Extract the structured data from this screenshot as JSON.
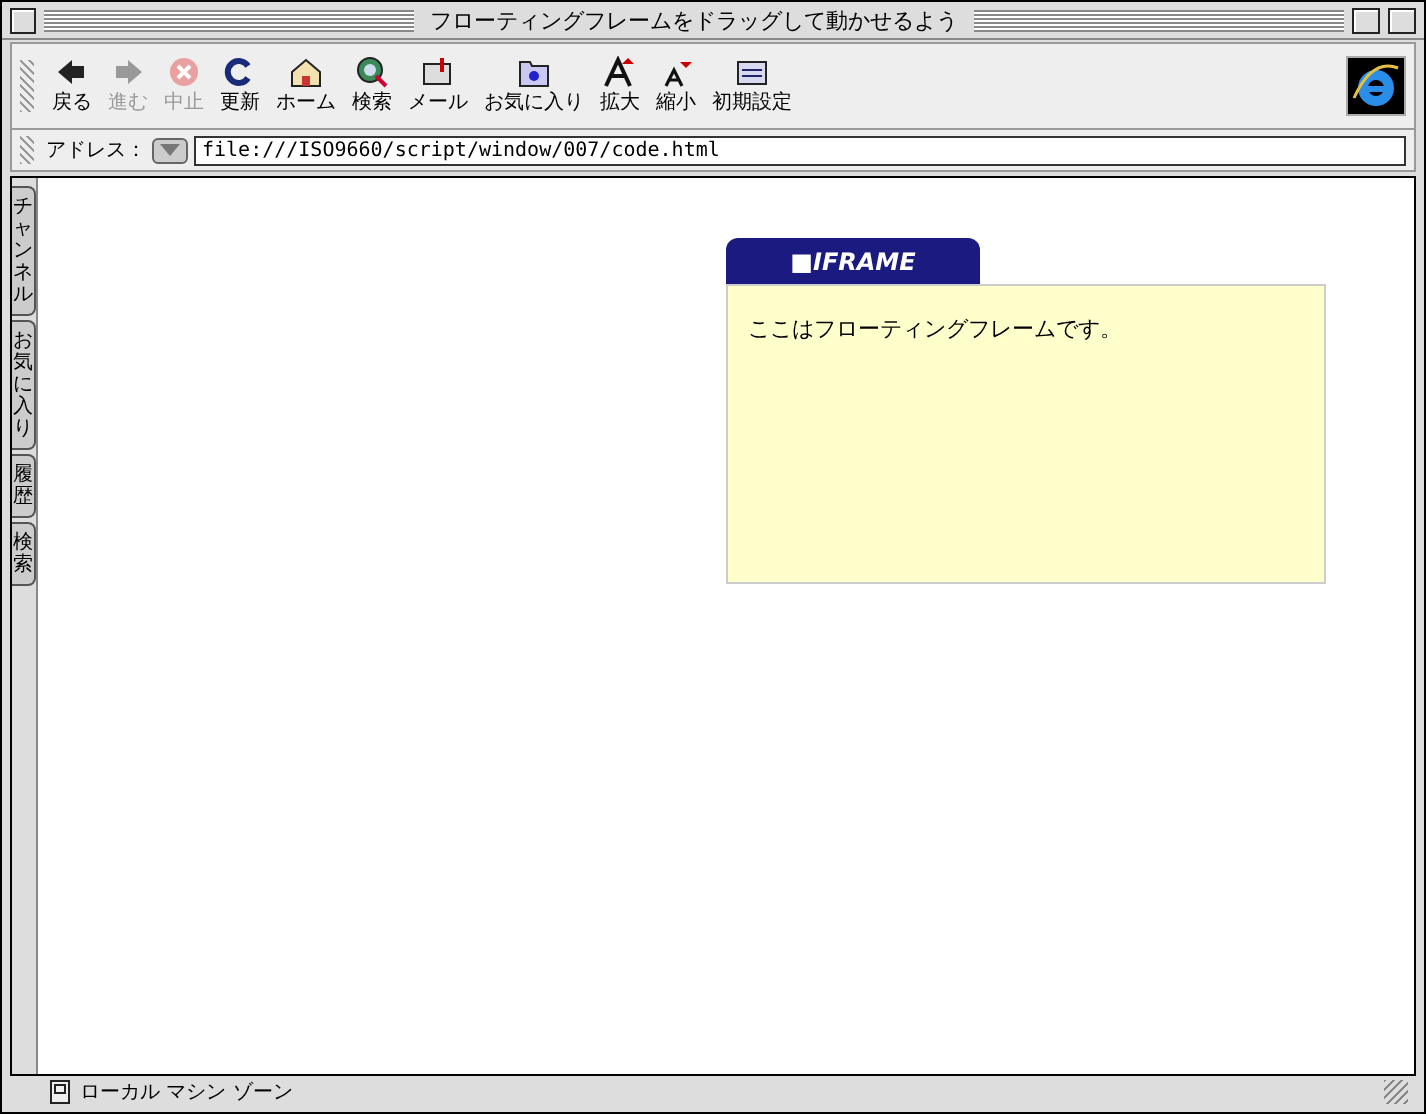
{
  "window": {
    "title": "フローティングフレームをドラッグして動かせるよう"
  },
  "toolbar": {
    "buttons": [
      {
        "kind": "back",
        "label": "戻る",
        "disabled": false
      },
      {
        "kind": "forward",
        "label": "進む",
        "disabled": true
      },
      {
        "kind": "stop",
        "label": "中止",
        "disabled": true
      },
      {
        "kind": "refresh",
        "label": "更新",
        "disabled": false
      },
      {
        "kind": "home",
        "label": "ホーム",
        "disabled": false
      },
      {
        "kind": "search",
        "label": "検索",
        "disabled": false
      },
      {
        "kind": "mail",
        "label": "メール",
        "disabled": false
      },
      {
        "kind": "favorites",
        "label": "お気に入り",
        "disabled": false
      },
      {
        "kind": "larger",
        "label": "拡大",
        "disabled": false
      },
      {
        "kind": "smaller",
        "label": "縮小",
        "disabled": false
      },
      {
        "kind": "preferences",
        "label": "初期設定",
        "disabled": false
      }
    ]
  },
  "address_bar": {
    "label": "アドレス：",
    "value": "file:///ISO9660/script/window/007/code.html"
  },
  "side_tabs": [
    {
      "label": "チャンネル"
    },
    {
      "label": "お気に入り"
    },
    {
      "label": "履歴"
    },
    {
      "label": "検索"
    }
  ],
  "floating_frame": {
    "tab": "■IFRAME",
    "text": "ここはフローティングフレームです。"
  },
  "status_bar": {
    "text": "ローカル マシン ゾーン"
  }
}
